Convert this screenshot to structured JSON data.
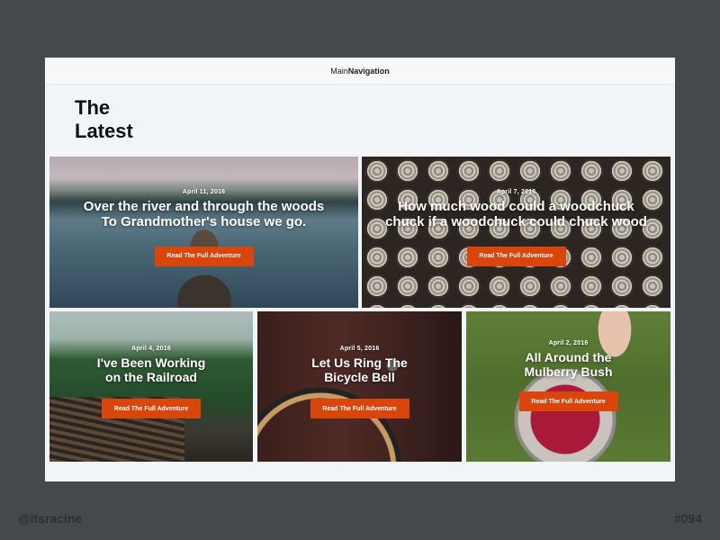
{
  "nav": {
    "prefix": "Main",
    "bold": "Navigation"
  },
  "heading": {
    "line1": "The",
    "line2": "Latest"
  },
  "cards": [
    {
      "date": "April 11, 2016",
      "title_line1": "Over the river and through the woods",
      "title_line2": "To Grandmother's house we go.",
      "button": "Read The Full Adventure"
    },
    {
      "date": "April 7, 2016",
      "title_line1": "How much wood could a woodchuck",
      "title_line2": "chuck if a woodchuck could chuck wood",
      "button": "Read The Full Adventure"
    },
    {
      "date": "April 4, 2016",
      "title_line1": "I've Been Working",
      "title_line2": "on the Railroad",
      "button": "Read The Full Adventure"
    },
    {
      "date": "April 5, 2016",
      "title_line1": "Let Us Ring The",
      "title_line2": "Bicycle Bell",
      "button": "Read The Full Adventure"
    },
    {
      "date": "April 2, 2016",
      "title_line1": "All Around the",
      "title_line2": "Mulberry Bush",
      "button": "Read The Full Adventure"
    }
  ],
  "footer": {
    "author": "@itsracine",
    "number": "#094"
  },
  "colors": {
    "accent": "#d9450b",
    "page_bg": "#46494c",
    "frame_bg": "#f2f5f8"
  }
}
